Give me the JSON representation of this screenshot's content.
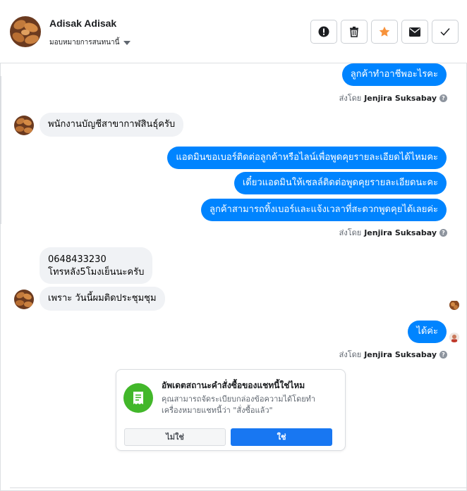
{
  "header": {
    "contact_name": "Adisak Adisak",
    "assign_label": "มอบหมายการสนทนานี้",
    "actions": [
      {
        "icon": "alert-icon",
        "name": "mark-spam-button"
      },
      {
        "icon": "trash-icon",
        "name": "delete-button"
      },
      {
        "icon": "star-icon",
        "name": "star-button"
      },
      {
        "icon": "envelope-icon",
        "name": "mark-unread-button"
      },
      {
        "icon": "check-icon",
        "name": "mark-done-button"
      }
    ]
  },
  "messages": {
    "m1": "ลูกค้าทำอาชีพอะไรคะ",
    "sent1_prefix": "ส่งโดย",
    "sent1_name": "Jenjira Suksabay",
    "m2": "พนักงานบัญชีสาขากาฬสินธุ์ครับ",
    "m3": "แอดมินขอเบอร์ติดต่อลูกค้าหรือไลน์เพื่อพูดคุยรายละเอียดได้ไหมคะ",
    "m4": "เดี๋ยวแอดมินให้เซลล์ติดต่อพูดคุยรายละเอียดนะคะ",
    "m5": "ลูกค้าสามารถทิ้งเบอร์และแจ้งเวลาที่สะดวกพูดคุยได้เลยค่ะ",
    "sent2_prefix": "ส่งโดย",
    "sent2_name": "Jenjira Suksabay",
    "m6_line1": "0648433230",
    "m6_line2": "โทรหลัง5โมงเย็นนะครับ",
    "m7": "เพราะ วันนี้ผมติดประชุมชุม",
    "m8": "ได้ค่ะ",
    "sent3_prefix": "ส่งโดย",
    "sent3_name": "Jenjira Suksabay"
  },
  "card": {
    "title": "อัพเดตสถานะคำสั่งซื้อของแชทนี้ใช่ไหม",
    "description": "คุณสามารถจัดระเบียบกล่องข้อความได้โดยทำเครื่องหมายแชทนี้ว่า \"สั่งซื้อแล้ว\"",
    "no_label": "ไม่ใช่",
    "yes_label": "ใช่"
  },
  "colors": {
    "outgoing": "#0084ff",
    "incoming": "#f0f2f5",
    "star": "#f7923b",
    "primary_button": "#1877f2",
    "card_icon": "#42b72a"
  }
}
